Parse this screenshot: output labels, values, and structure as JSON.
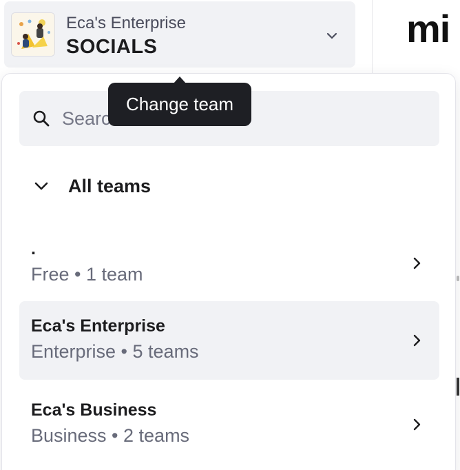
{
  "background": {
    "logo_text": "mi"
  },
  "switcher": {
    "org_name": "Eca's Enterprise",
    "team_name": "SOCIALS",
    "avatar_icon": "team-illustration",
    "chevron_icon": "chevron-down-icon"
  },
  "tooltip": {
    "text": "Change team"
  },
  "dropdown": {
    "search": {
      "placeholder": "Search",
      "icon": "search-icon"
    },
    "section_label": "All teams",
    "organizations": [
      {
        "name": ".",
        "meta": "Free • 1 team",
        "selected": false
      },
      {
        "name": "Eca's Enterprise",
        "meta": "Enterprise • 5 teams",
        "selected": true
      },
      {
        "name": "Eca's Business",
        "meta": "Business • 2 teams",
        "selected": false
      }
    ]
  },
  "colors": {
    "surface": "#f1f2f5",
    "text_primary": "#1c1c1e",
    "text_secondary": "#686b7a",
    "tooltip_bg": "#1e1f24"
  }
}
